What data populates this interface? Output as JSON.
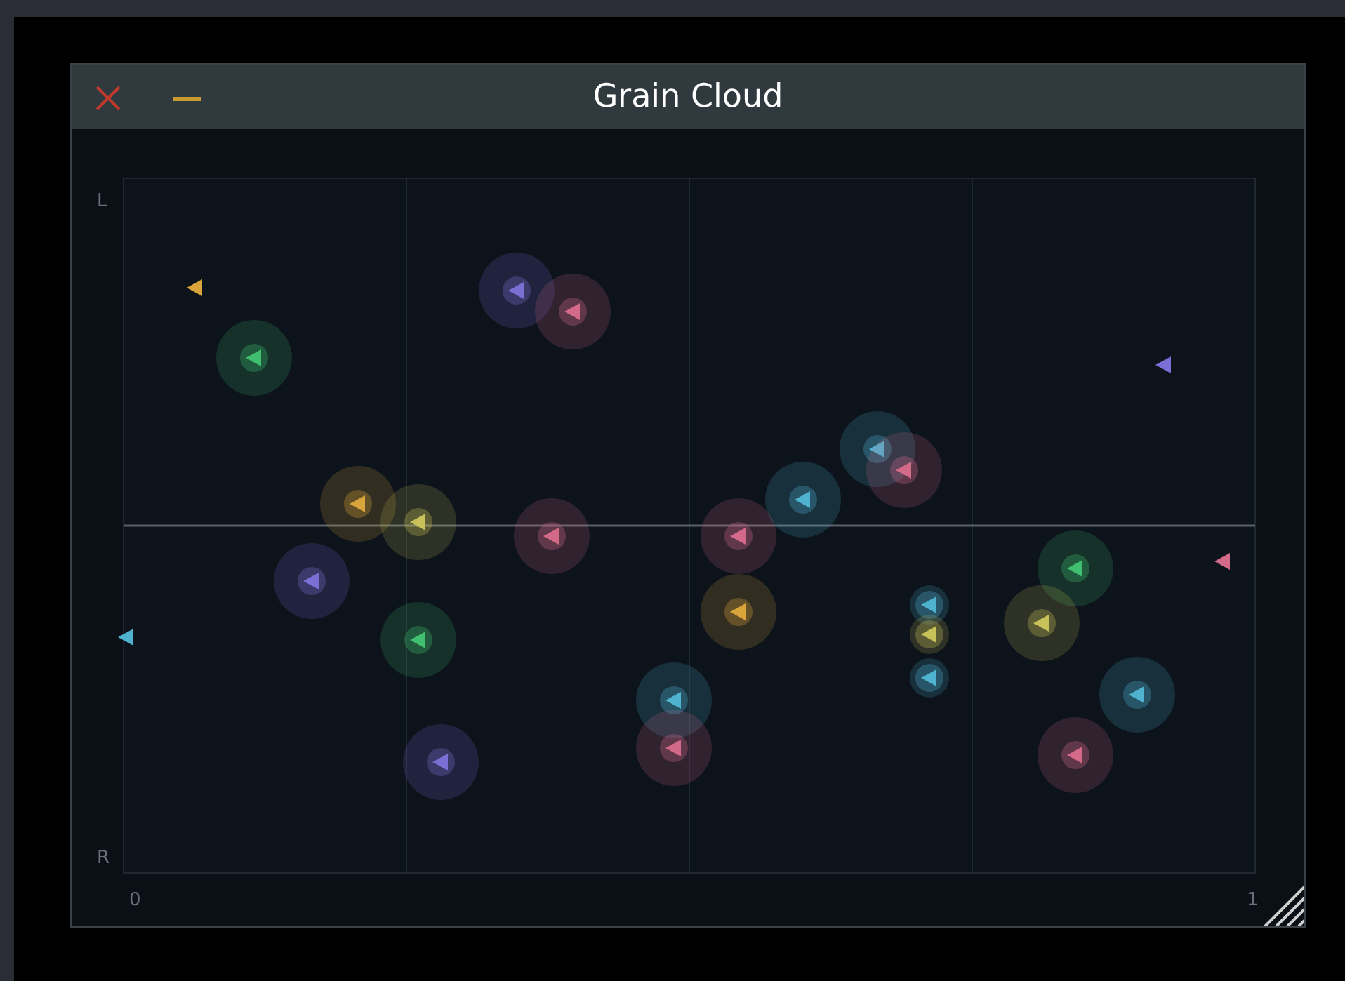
{
  "window": {
    "title": "Grain Cloud"
  },
  "plot": {
    "y_axis_labels": {
      "top": "L",
      "bottom": "R"
    },
    "x_axis_labels": {
      "start": "0",
      "end": "1"
    },
    "grains": [
      {
        "color": "#d9a43a"
      },
      {
        "color": "#3fbf6f"
      },
      {
        "color": "#7b6fd6"
      },
      {
        "color": "#d46a8a"
      },
      {
        "color": "#7b6fd6"
      },
      {
        "color": "#4fb3d0"
      },
      {
        "color": "#d46a8a"
      },
      {
        "color": "#4fb3d0"
      },
      {
        "color": "#d9a43a"
      },
      {
        "color": "#c9c25a"
      },
      {
        "color": "#d46a8a"
      },
      {
        "color": "#d46a8a"
      },
      {
        "color": "#7b6fd6"
      },
      {
        "color": "#d46a8a"
      },
      {
        "color": "#3fbf6f"
      },
      {
        "color": "#d9a43a"
      },
      {
        "color": "#4fb3d0"
      },
      {
        "color": "#c9c25a"
      },
      {
        "color": "#c9c25a"
      },
      {
        "color": "#4fb3d0"
      },
      {
        "color": "#3fbf6f"
      },
      {
        "color": "#4fb3d0"
      },
      {
        "color": "#4fb3d0"
      },
      {
        "color": "#4fb3d0"
      },
      {
        "color": "#d46a8a"
      },
      {
        "color": "#7b6fd6"
      },
      {
        "color": "#d46a8a"
      }
    ]
  }
}
